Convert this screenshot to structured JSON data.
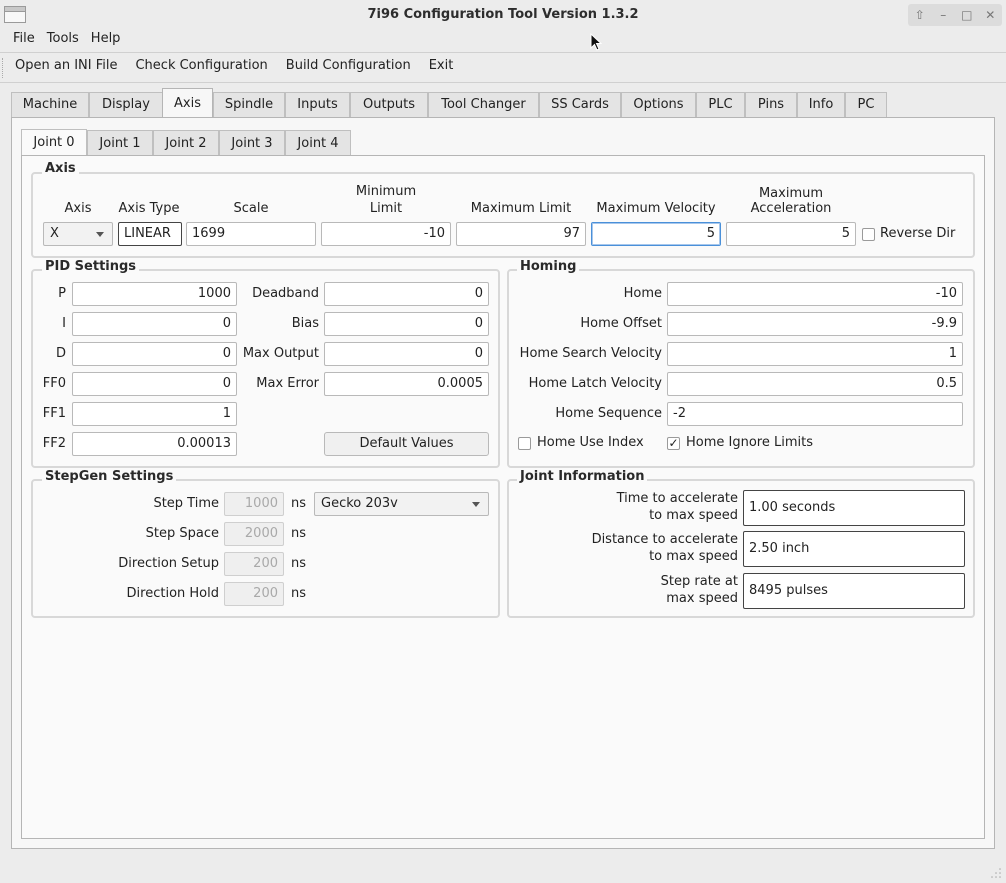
{
  "window": {
    "title": "7i96 Configuration Tool Version 1.3.2"
  },
  "menu": {
    "items": [
      "File",
      "Tools",
      "Help"
    ]
  },
  "toolbar": {
    "items": [
      "Open an INI File",
      "Check Configuration",
      "Build Configuration",
      "Exit"
    ]
  },
  "tabs": [
    "Machine",
    "Display",
    "Axis",
    "Spindle",
    "Inputs",
    "Outputs",
    "Tool Changer",
    "SS Cards",
    "Options",
    "PLC",
    "Pins",
    "Info",
    "PC"
  ],
  "active_tab": "Axis",
  "joint_tabs": [
    "Joint 0",
    "Joint 1",
    "Joint 2",
    "Joint 3",
    "Joint 4"
  ],
  "axis": {
    "title": "Axis",
    "axis_label": "Axis",
    "axis_value": "X",
    "type_label": "Axis Type",
    "type_value": "LINEAR",
    "scale_label": "Scale",
    "scale_value": "1699",
    "min_label_1": "Minimum",
    "min_label_2": "Limit",
    "min_value": "-10",
    "max_label": "Maximum Limit",
    "max_value": "97",
    "vel_label": "Maximum Velocity",
    "vel_value": "5",
    "acc_label_1": "Maximum",
    "acc_label_2": "Acceleration",
    "acc_value": "5",
    "reverse_label": "Reverse Dir"
  },
  "pid": {
    "title": "PID Settings",
    "p_label": "P",
    "p_value": "1000",
    "i_label": "I",
    "i_value": "0",
    "d_label": "D",
    "d_value": "0",
    "ff0_label": "FF0",
    "ff0_value": "0",
    "ff1_label": "FF1",
    "ff1_value": "1",
    "ff2_label": "FF2",
    "ff2_value": "0.00013",
    "deadband_label": "Deadband",
    "deadband_value": "0",
    "bias_label": "Bias",
    "bias_value": "0",
    "maxout_label": "Max Output",
    "maxout_value": "0",
    "maxerr_label": "Max Error",
    "maxerr_value": "0.0005",
    "default_button": "Default Values"
  },
  "homing": {
    "title": "Homing",
    "home_label": "Home",
    "home_value": "-10",
    "offset_label": "Home Offset",
    "offset_value": "-9.9",
    "search_label": "Home Search Velocity",
    "search_value": "1",
    "latch_label": "Home Latch Velocity",
    "latch_value": "0.5",
    "seq_label": "Home Sequence",
    "seq_value": "-2",
    "use_index_label": "Home Use Index",
    "ignore_limits_label": "Home Ignore Limits",
    "ignore_limits_check": "✓"
  },
  "stepgen": {
    "title": "StepGen Settings",
    "step_time_label": "Step Time",
    "step_time_value": "1000",
    "step_space_label": "Step Space",
    "step_space_value": "2000",
    "dir_setup_label": "Direction Setup",
    "dir_setup_value": "200",
    "dir_hold_label": "Direction Hold",
    "dir_hold_value": "200",
    "unit": "ns",
    "driver": "Gecko 203v"
  },
  "joint_info": {
    "title": "Joint Information",
    "accel_time_label_1": "Time to accelerate",
    "accel_time_label_2": "to max speed",
    "accel_time_value": "1.00 seconds",
    "accel_dist_label_1": "Distance to accelerate",
    "accel_dist_label_2": "to max speed",
    "accel_dist_value": "2.50 inch",
    "step_rate_label_1": "Step rate at",
    "step_rate_label_2": "max speed",
    "step_rate_value": "8495 pulses"
  }
}
